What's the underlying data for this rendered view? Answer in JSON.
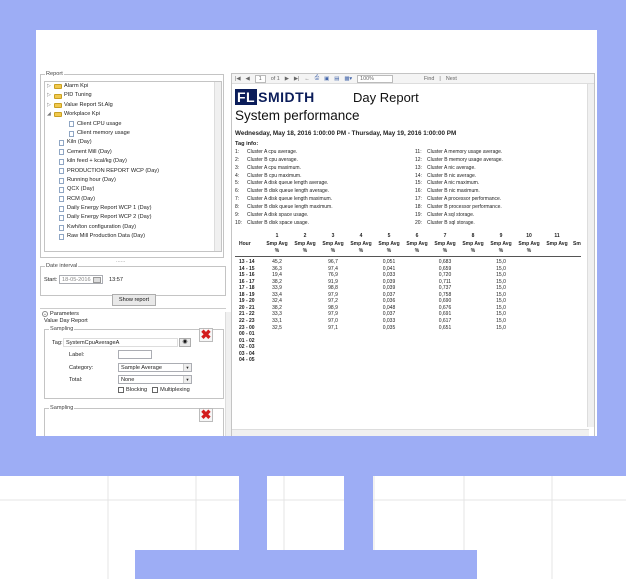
{
  "report_panel": {
    "legend": "Report",
    "tree": [
      {
        "label": "Alarm Kpi",
        "level": 0,
        "type": "folder",
        "expanded": false
      },
      {
        "label": "PID Tuning",
        "level": 0,
        "type": "folder",
        "expanded": false
      },
      {
        "label": "Value Report St.Alg",
        "level": 0,
        "type": "folder",
        "expanded": false
      },
      {
        "label": "Workplace Kpi",
        "level": 0,
        "type": "folder",
        "expanded": true
      },
      {
        "label": "Client CPU usage",
        "level": 1,
        "type": "doc"
      },
      {
        "label": "Client memory usage",
        "level": 1,
        "type": "doc"
      },
      {
        "label": "Kiln (Day)",
        "level": 0,
        "type": "doc"
      },
      {
        "label": "Cement Mill (Day)",
        "level": 0,
        "type": "doc"
      },
      {
        "label": "kiln feed + kcal/kg (Day)",
        "level": 0,
        "type": "doc"
      },
      {
        "label": "PRODUCTION REPORT WCP (Day)",
        "level": 0,
        "type": "doc"
      },
      {
        "label": "Running hour (Day)",
        "level": 0,
        "type": "doc"
      },
      {
        "label": "QCX (Day)",
        "level": 0,
        "type": "doc"
      },
      {
        "label": "RCM (Day)",
        "level": 0,
        "type": "doc"
      },
      {
        "label": "Daily Energy Report WCP 1 (Day)",
        "level": 0,
        "type": "doc"
      },
      {
        "label": "Daily Energy Report WCP 2 (Day)",
        "level": 0,
        "type": "doc"
      },
      {
        "label": "Kwh/ton configuration (Day)",
        "level": 0,
        "type": "doc"
      },
      {
        "label": "Raw Mill Production Data (Day)",
        "level": 0,
        "type": "doc"
      }
    ],
    "splitter_dots": "......"
  },
  "date_interval": {
    "legend": "Date interval",
    "start_label": "Start:",
    "date_value": "18-05-2016",
    "time_value": "13:57",
    "show_button": "Show report"
  },
  "parameters": {
    "header": "Parameters",
    "group_title": "Value Day Report",
    "sampling_legend": "Sampling",
    "tag_label": "Tag:",
    "tag_value": "SystemCpuAverageA",
    "label_label": "Label:",
    "label_value": "",
    "category_label": "Category:",
    "category_value": "Sample Average",
    "total_label": "Total:",
    "total_value": "None",
    "blocking_label": "Blocking",
    "multiplexing_label": "Multiplexing",
    "sampling2_legend": "Sampling"
  },
  "toolbar": {
    "page_of": "of 1",
    "page_current": "1",
    "zoom": "100%",
    "find": "Find",
    "next": "Next"
  },
  "report": {
    "logo_box": "FL",
    "logo_text": "SMIDTH",
    "title": "Day Report",
    "subtitle": "System performance",
    "range": "Wednesday, May 18, 2016 1:00:00 PM - Thursday, May 19, 2016 1:00:00 PM",
    "tag_info_header": "Tag info:",
    "tag_info_left": [
      {
        "n": "1:",
        "t": "Cluster A cpu average."
      },
      {
        "n": "2:",
        "t": "Cluster B cpu average."
      },
      {
        "n": "3:",
        "t": "Cluster A cpu maximum."
      },
      {
        "n": "4:",
        "t": "Cluster B cpu maximum."
      },
      {
        "n": "5:",
        "t": "Cluster A disk queue length average."
      },
      {
        "n": "6:",
        "t": "Cluster B disk queue length average."
      },
      {
        "n": "7:",
        "t": "Cluster A disk queue length maximum."
      },
      {
        "n": "8:",
        "t": "Cluster B disk queue length maximum."
      },
      {
        "n": "9:",
        "t": "Cluster A disk space usage."
      },
      {
        "n": "10:",
        "t": "Cluster B disk space usage."
      }
    ],
    "tag_info_right": [
      {
        "n": "11:",
        "t": "Cluster A memory usage average."
      },
      {
        "n": "12:",
        "t": "Cluster B memory usage average."
      },
      {
        "n": "13:",
        "t": "Cluster A nic average."
      },
      {
        "n": "14:",
        "t": "Cluster B nic average."
      },
      {
        "n": "15:",
        "t": "Cluster A nic maximum."
      },
      {
        "n": "16:",
        "t": "Cluster B nic maximum."
      },
      {
        "n": "17:",
        "t": "Cluster A processor performance."
      },
      {
        "n": "18:",
        "t": "Cluster B processor performance."
      },
      {
        "n": "19:",
        "t": "Cluster A sql storage."
      },
      {
        "n": "20:",
        "t": "Cluster B sql storage."
      }
    ],
    "col_numbers": [
      "1",
      "2",
      "3",
      "4",
      "5",
      "6",
      "7",
      "8",
      "9",
      "10",
      "11"
    ],
    "hour_header": "Hour",
    "col_header": "Smp Avg",
    "col_unit": "%",
    "col_trunc": "Sm",
    "rows": [
      {
        "h": "13 - 14",
        "v": [
          "45,2",
          "",
          "96,7",
          "",
          "0,051",
          "",
          "0,683",
          "",
          "15,0"
        ]
      },
      {
        "h": "14 - 15",
        "v": [
          "36,3",
          "",
          "97,4",
          "",
          "0,041",
          "",
          "0,659",
          "",
          "15,0"
        ]
      },
      {
        "h": "15 - 16",
        "v": [
          "19,4",
          "",
          "76,9",
          "",
          "0,033",
          "",
          "0,720",
          "",
          "15,0"
        ]
      },
      {
        "h": "16 - 17",
        "v": [
          "38,2",
          "",
          "91,9",
          "",
          "0,039",
          "",
          "0,711",
          "",
          "15,0"
        ]
      },
      {
        "h": "17 - 18",
        "v": [
          "33,9",
          "",
          "98,8",
          "",
          "0,039",
          "",
          "0,737",
          "",
          "15,0"
        ]
      },
      {
        "h": "18 - 19",
        "v": [
          "33,4",
          "",
          "97,9",
          "",
          "0,037",
          "",
          "0,758",
          "",
          "15,0"
        ]
      },
      {
        "h": "19 - 20",
        "v": [
          "32,4",
          "",
          "97,2",
          "",
          "0,036",
          "",
          "0,690",
          "",
          "15,0"
        ]
      },
      {
        "h": "20 - 21",
        "v": [
          "38,2",
          "",
          "98,9",
          "",
          "0,048",
          "",
          "0,676",
          "",
          "15,0"
        ]
      },
      {
        "h": "21 - 22",
        "v": [
          "33,3",
          "",
          "97,9",
          "",
          "0,037",
          "",
          "0,691",
          "",
          "15,0"
        ]
      },
      {
        "h": "22 - 23",
        "v": [
          "33,1",
          "",
          "97,0",
          "",
          "0,033",
          "",
          "0,617",
          "",
          "15,0"
        ]
      },
      {
        "h": "23 - 00",
        "v": [
          "32,5",
          "",
          "97,1",
          "",
          "0,035",
          "",
          "0,651",
          "",
          "15,0"
        ]
      },
      {
        "h": "00 - 01",
        "v": [
          "",
          "",
          "",
          "",
          "",
          "",
          "",
          "",
          ""
        ]
      },
      {
        "h": "01 - 02",
        "v": [
          "",
          "",
          "",
          "",
          "",
          "",
          "",
          "",
          ""
        ]
      },
      {
        "h": "02 - 03",
        "v": [
          "",
          "",
          "",
          "",
          "",
          "",
          "",
          "",
          ""
        ]
      },
      {
        "h": "03 - 04",
        "v": [
          "",
          "",
          "",
          "",
          "",
          "",
          "",
          "",
          ""
        ]
      },
      {
        "h": "04 - 05",
        "v": [
          "",
          "",
          "",
          "",
          "",
          "",
          "",
          "",
          ""
        ]
      }
    ]
  },
  "colors": {
    "frame": "#9dadf5",
    "logo": "#0b1d5a",
    "delete": "#d21c1c"
  }
}
